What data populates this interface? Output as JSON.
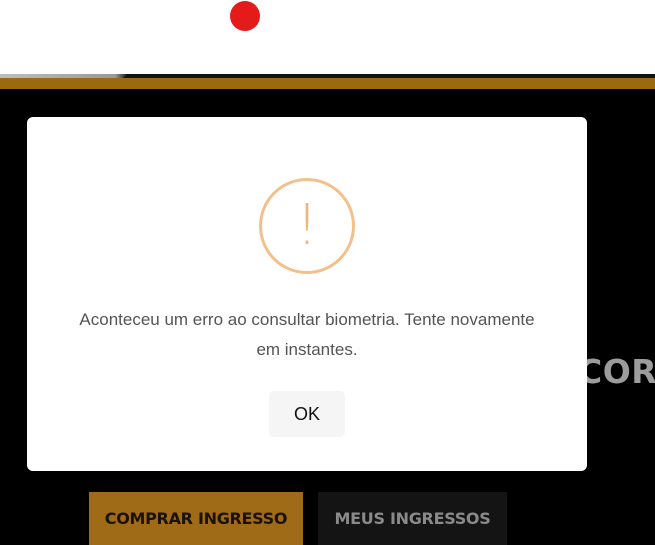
{
  "header": {
    "notification_dot_color": "#e31b1b",
    "accent_bar_color": "#9a6a10"
  },
  "background": {
    "heading_fragment": "CORR"
  },
  "actions": {
    "buy_ticket_label": "COMPRAR INGRESSO",
    "my_tickets_label": "MEUS INGRESSOS"
  },
  "modal": {
    "icon": "warning-exclamation-icon",
    "icon_glyph": "!",
    "message": "Aconteceu um erro ao consultar biometria. Tente novamente em instantes.",
    "ok_label": "OK"
  }
}
